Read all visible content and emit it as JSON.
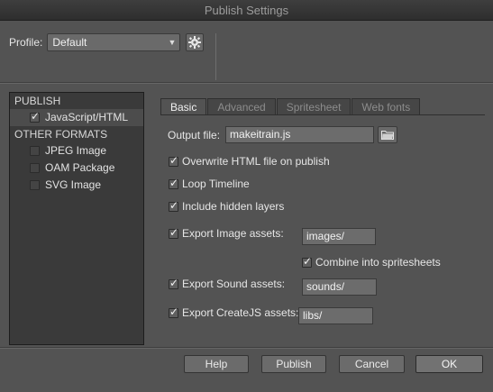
{
  "window": {
    "title": "Publish Settings"
  },
  "profile": {
    "label": "Profile:",
    "value": "Default",
    "gear_icon": "gear-icon"
  },
  "left_panel": {
    "publish_header": "PUBLISH",
    "publish_items": [
      {
        "label": "JavaScript/HTML",
        "checked": true
      }
    ],
    "other_header": "OTHER FORMATS",
    "other_items": [
      {
        "label": "JPEG Image",
        "checked": false
      },
      {
        "label": "OAM Package",
        "checked": false
      },
      {
        "label": "SVG Image",
        "checked": false
      }
    ]
  },
  "tabs": [
    {
      "label": "Basic",
      "active": true
    },
    {
      "label": "Advanced",
      "active": false
    },
    {
      "label": "Spritesheet",
      "active": false
    },
    {
      "label": "Web fonts",
      "active": false
    }
  ],
  "basic": {
    "output_file_label": "Output file:",
    "output_file_value": "makeitrain.js",
    "overwrite_label": "Overwrite HTML file on publish",
    "loop_label": "Loop Timeline",
    "hidden_layers_label": "Include hidden layers",
    "export_image_label": "Export Image assets:",
    "export_image_value": "images/",
    "combine_label": "Combine into spritesheets",
    "export_sound_label": "Export Sound assets:",
    "export_sound_value": "sounds/",
    "export_createjs_label": "Export CreateJS assets:",
    "export_createjs_value": "libs/"
  },
  "buttons": {
    "help": "Help",
    "publish": "Publish",
    "cancel": "Cancel",
    "ok": "OK"
  }
}
